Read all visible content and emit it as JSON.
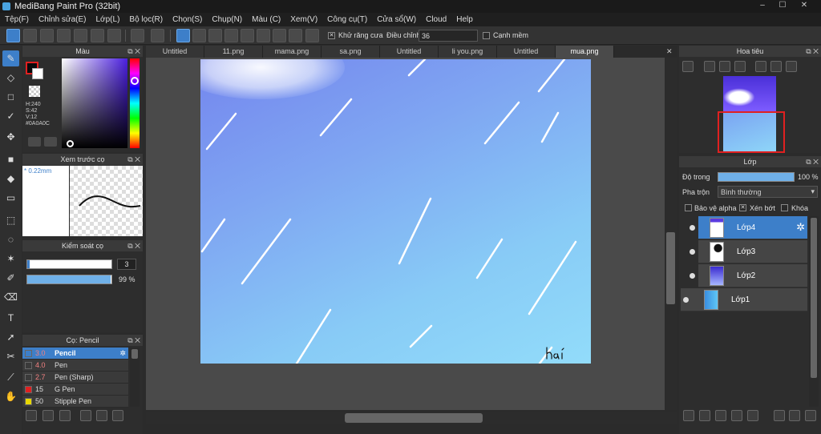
{
  "window": {
    "title": "MediBang Paint Pro (32bit)",
    "minimize": "–",
    "maximize": "☐",
    "close": "✕"
  },
  "menu": [
    "Tệp(F)",
    "Chỉnh sửa(E)",
    "Lớp(L)",
    "Bộ lọc(R)",
    "Chọn(S)",
    "Chụp(N)",
    "Màu (C)",
    "Xem(V)",
    "Công cụ(T)",
    "Cửa sổ(W)",
    "Cloud",
    "Help"
  ],
  "toolbar": {
    "antialias_label": "Khử răng cưa",
    "antialias_checked": "✕",
    "correction_label": "Điều chỉnh",
    "correction_value": "36",
    "edge_label": "Cạnh mềm"
  },
  "color_panel": {
    "title": "Màu",
    "h": "H:240",
    "s": "S:42",
    "v": "V:12",
    "hex": "#0A0A0C"
  },
  "brush_preview": {
    "title": "Xem trước cọ",
    "size": "* 0.22mm"
  },
  "brush_control": {
    "title": "Kiểm soát cọ",
    "size": "3",
    "opacity": "99 %",
    "opacity_value": 0.99
  },
  "brush_list": {
    "title": "Cọ: Pencil",
    "items": [
      {
        "size": "3.0",
        "name": "Pencil",
        "color": "#1a1a1a"
      },
      {
        "size": "4.0",
        "name": "Pen",
        "color": "#1a1a1a"
      },
      {
        "size": "2.7",
        "name": "Pen (Sharp)",
        "color": "#1a1a1a"
      },
      {
        "size": "15",
        "name": "G Pen",
        "color": "#e02020"
      },
      {
        "size": "50",
        "name": "Stipple Pen",
        "color": "#e8d800"
      }
    ]
  },
  "tabs": [
    "Untitled",
    "11.png",
    "mama.png",
    "sa.png",
    "Untitled",
    "li you.png",
    "Untitled",
    "mua.png"
  ],
  "navigator": {
    "title": "Hoa tiêu"
  },
  "layer_panel": {
    "title": "Lớp",
    "opacity_label": "Độ trong",
    "opacity_value": "100 %",
    "blend_label": "Pha trộn",
    "blend_value": "Bình thường",
    "protect_alpha": "Bảo vệ alpha",
    "clipping": "Xén bớt",
    "lock": "Khóa",
    "clipping_mark": "✕"
  },
  "layers": [
    {
      "name": "Lớp4"
    },
    {
      "name": "Lớp3"
    },
    {
      "name": "Lớp2"
    },
    {
      "name": "Lớp1"
    }
  ],
  "canvas": {
    "signature": "hai"
  },
  "colors": {
    "accent": "#3d7fc9"
  }
}
